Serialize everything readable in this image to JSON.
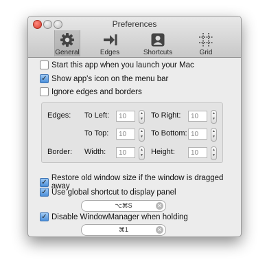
{
  "window": {
    "title": "Preferences"
  },
  "tabs": [
    {
      "label": "General",
      "icon": "gear-icon",
      "active": true
    },
    {
      "label": "Edges",
      "icon": "arrow-to-edge-icon"
    },
    {
      "label": "Shortcuts",
      "icon": "person-card-icon"
    },
    {
      "label": "Grid",
      "icon": "grid-icon"
    }
  ],
  "options": {
    "start_at_launch": {
      "label": "Start this app when you launch your Mac",
      "checked": false
    },
    "show_menu_icon": {
      "label": "Show app's icon on the menu bar",
      "checked": true
    },
    "ignore_edges": {
      "label": "Ignore edges and borders",
      "checked": false
    },
    "restore_size": {
      "label": "Restore old window size if the window is dragged away",
      "checked": true
    },
    "global_shortcut": {
      "label": "Use global shortcut to display panel",
      "checked": true
    },
    "disable_wm": {
      "label": "Disable WindowManager when holding",
      "checked": true
    }
  },
  "edges": {
    "label": "Edges:",
    "to_left": {
      "label": "To Left:",
      "value": "10"
    },
    "to_right": {
      "label": "To Right:",
      "value": "10"
    },
    "to_top": {
      "label": "To Top:",
      "value": "10"
    },
    "to_bottom": {
      "label": "To Bottom:",
      "value": "10"
    }
  },
  "border": {
    "label": "Border:",
    "width": {
      "label": "Width:",
      "value": "10"
    },
    "height": {
      "label": "Height:",
      "value": "10"
    }
  },
  "shortcuts": {
    "global": "⌥⌘S",
    "disable": "⌘1"
  }
}
